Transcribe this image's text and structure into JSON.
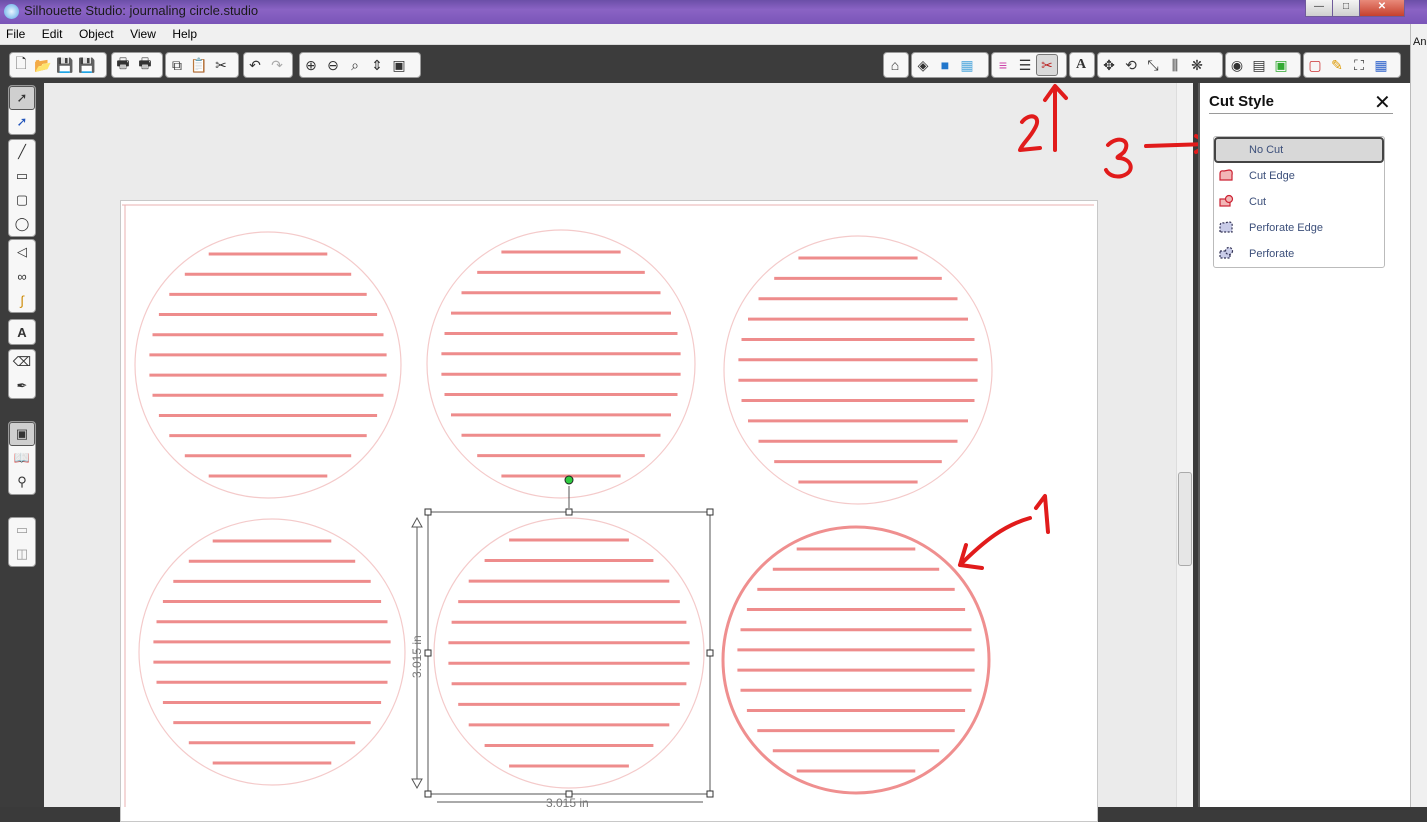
{
  "window": {
    "title": "Silhouette Studio: journaling circle.studio",
    "min": "—",
    "max": "□",
    "close": "✕"
  },
  "menu": [
    "File",
    "Edit",
    "Object",
    "View",
    "Help"
  ],
  "toolbar": {
    "file_icons": [
      "new-document-icon",
      "open-icon",
      "save-icon",
      "save-to-library-icon"
    ],
    "print_icons": [
      "print-icon",
      "print-and-cut-icon"
    ],
    "edit_icons": [
      "copy-icon",
      "paste-icon",
      "cut-icon"
    ],
    "undo_icons": [
      "undo-icon",
      "redo-icon"
    ],
    "zoom_icons": [
      "zoom-in-icon",
      "zoom-out-icon",
      "zoom-select-icon",
      "zoom-drag-icon",
      "fit-to-page-icon"
    ],
    "right_icons": [
      "store-icon",
      "fill-color-icon",
      "fill-gradient-icon",
      "fill-pattern-icon",
      "line-color-icon",
      "line-style-icon",
      "cut-style-icon",
      "text-style-icon",
      "transform-icon",
      "rotate-icon",
      "scale-icon",
      "align-icon",
      "replicate-icon",
      "trace-icon",
      "layers-icon",
      "offset-icon",
      "page-setup-icon",
      "sketch-icon",
      "fullscreen-icon",
      "grid-icon"
    ],
    "active": "cut-style-icon"
  },
  "tools": {
    "select": [
      "select-icon",
      "edit-points-icon"
    ],
    "draw": [
      "line-icon",
      "rectangle-icon",
      "rounded-rectangle-icon",
      "ellipse-icon"
    ],
    "freehand": [
      "polygon-icon",
      "curve-icon",
      "freehand-icon"
    ],
    "text": [
      "text-icon"
    ],
    "misc": [
      "eraser-icon",
      "knife-icon"
    ],
    "view": [
      "design-page-icon",
      "library-icon",
      "store-icon"
    ],
    "layout": [
      "page-view-icon",
      "split-view-icon"
    ]
  },
  "selection": {
    "width_label": "3.015 in",
    "height_label": "3.015 in"
  },
  "annotations": {
    "one": "1",
    "two": "2",
    "three": "3"
  },
  "panel": {
    "title": "Cut Style",
    "close": "✕",
    "options": [
      "No Cut",
      "Cut Edge",
      "Cut",
      "Perforate Edge",
      "Perforate"
    ],
    "selected": "No Cut"
  },
  "right_edge_text": "An",
  "colors": {
    "line": "#ee8c8c",
    "circle_faint": "#f4caca",
    "circle_bold": "#ef8f8f",
    "annotation": "#e11b1b",
    "title_bar": "#7a55b8"
  }
}
